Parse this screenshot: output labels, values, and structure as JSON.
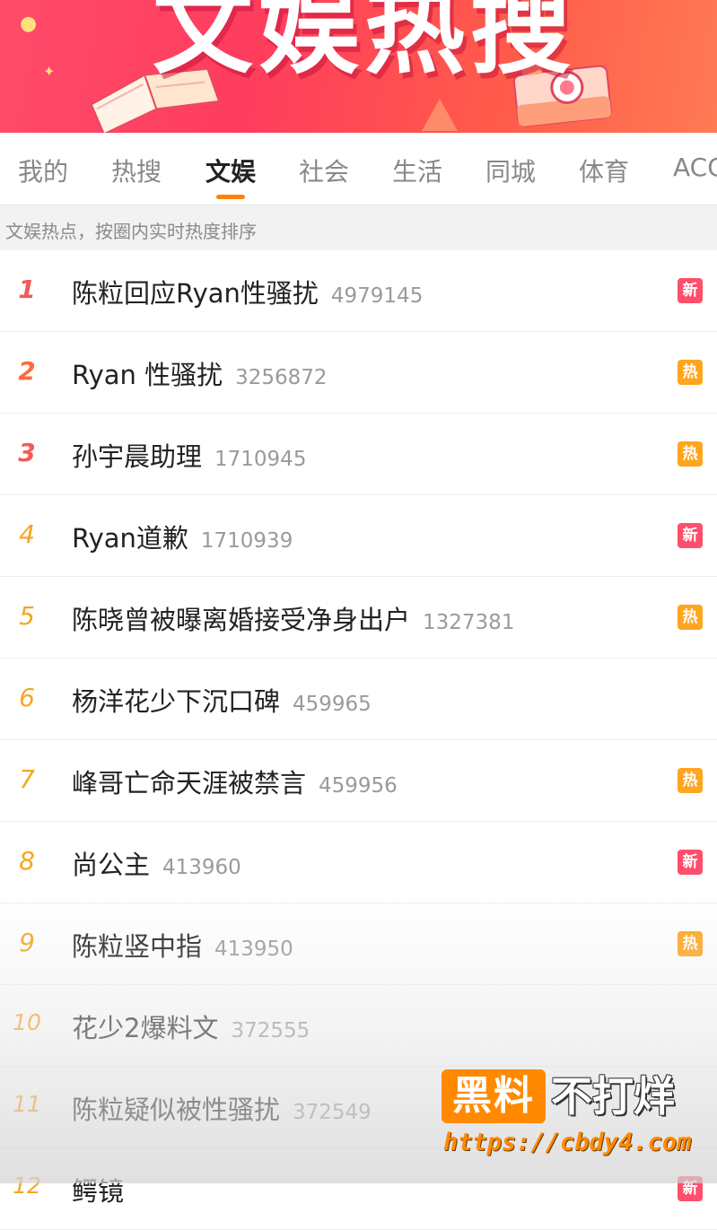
{
  "banner": {
    "title": "文娱热搜"
  },
  "tabs": [
    {
      "label": "我的"
    },
    {
      "label": "热搜"
    },
    {
      "label": "文娱"
    },
    {
      "label": "社会"
    },
    {
      "label": "生活"
    },
    {
      "label": "同城"
    },
    {
      "label": "体育"
    },
    {
      "label": "ACG"
    }
  ],
  "active_tab": "文娱",
  "subheader": "文娱热点，按圈内实时热度排序",
  "badge_labels": {
    "new": "新",
    "hot": "热"
  },
  "colors": {
    "accent": "#ff8200",
    "rank_top": "#f05a5a",
    "rank_normal": "#f5a623",
    "badge_new": "#ff4f6c",
    "badge_hot": "#ffa51f"
  },
  "items": [
    {
      "rank": "1",
      "topic": "陈粒回应Ryan性骚扰",
      "heat": "4979145",
      "badge": "新"
    },
    {
      "rank": "2",
      "topic": "Ryan 性骚扰",
      "heat": "3256872",
      "badge": "热"
    },
    {
      "rank": "3",
      "topic": "孙宇晨助理",
      "heat": "1710945",
      "badge": "热"
    },
    {
      "rank": "4",
      "topic": "Ryan道歉",
      "heat": "1710939",
      "badge": "新"
    },
    {
      "rank": "5",
      "topic": "陈晓曾被曝离婚接受净身出户",
      "heat": "1327381",
      "badge": "热"
    },
    {
      "rank": "6",
      "topic": "杨洋花少下沉口碑",
      "heat": "459965",
      "badge": ""
    },
    {
      "rank": "7",
      "topic": "峰哥亡命天涯被禁言",
      "heat": "459956",
      "badge": "热"
    },
    {
      "rank": "8",
      "topic": "尚公主",
      "heat": "413960",
      "badge": "新"
    },
    {
      "rank": "9",
      "topic": "陈粒竖中指",
      "heat": "413950",
      "badge": "热"
    },
    {
      "rank": "10",
      "topic": "花少2爆料文",
      "heat": "372555",
      "badge": ""
    },
    {
      "rank": "11",
      "topic": "陈粒疑似被性骚扰",
      "heat": "372549",
      "badge": ""
    },
    {
      "rank": "12",
      "topic": "鳄镜",
      "heat": "",
      "badge": "新"
    }
  ],
  "watermark": {
    "box": "黑料",
    "text": "不打烊",
    "url": "https://cbdy4.com"
  }
}
